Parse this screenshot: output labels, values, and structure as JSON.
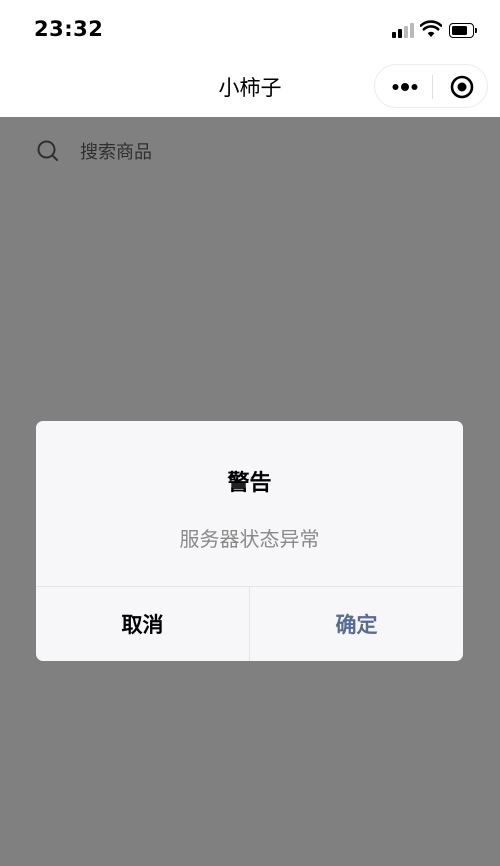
{
  "status_bar": {
    "time": "23:32"
  },
  "nav": {
    "title": "小柿子"
  },
  "search": {
    "placeholder": "搜索商品"
  },
  "modal": {
    "title": "警告",
    "message": "服务器状态异常",
    "cancel_label": "取消",
    "confirm_label": "确定"
  },
  "colors": {
    "overlay": "#808080",
    "confirm_text": "#576b95",
    "dialog_bg": "#f7f6f8"
  }
}
